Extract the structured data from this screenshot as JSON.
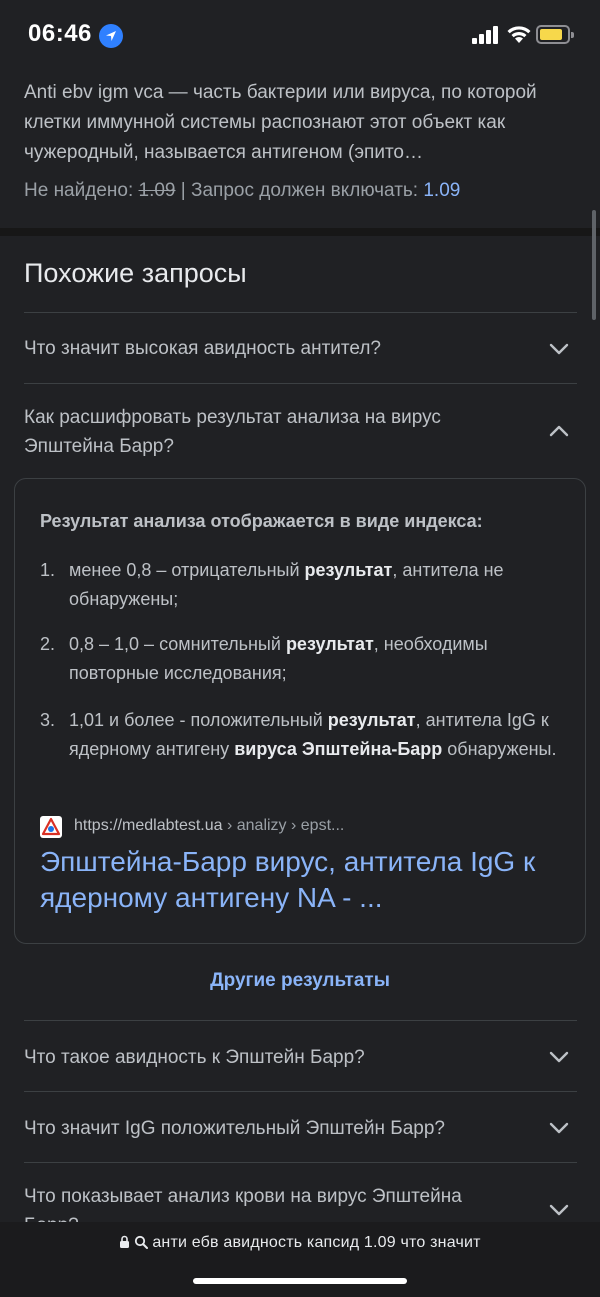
{
  "status": {
    "time": "06:46"
  },
  "snippet": {
    "text": "Anti ebv igm vca — часть бактерии или вируса, по которой клетки иммунной системы распознают этот объект как чужеродный, называется антигеном (эпито…",
    "missing_label": "Не найдено:",
    "missing_term": "1.09",
    "must_include_label": "| Запрос должен включать:",
    "must_include_term": "1.09"
  },
  "related": {
    "title": "Похожие запросы",
    "questions": [
      {
        "text": "Что значит высокая авидность антител?",
        "expanded": false
      },
      {
        "text": "Как расшифровать результат анализа на вирус Эпштейна Барр?",
        "expanded": true
      },
      {
        "text": "Что такое авидность к Эпштейн Барр?",
        "expanded": false
      },
      {
        "text": "Что значит IgG положительный Эпштейн Барр?",
        "expanded": false
      },
      {
        "text": "Что показывает анализ крови на вирус Эпштейна Барр?",
        "expanded": false
      }
    ]
  },
  "answer": {
    "heading": "Результат анализа отображается в виде индекса:",
    "items": [
      {
        "num": "1.",
        "pre": "менее 0,8 – отрицательный ",
        "bold1": "результат",
        "mid": ", антитела не обнаружены;",
        "bold2": "",
        "post": ""
      },
      {
        "num": "2.",
        "pre": "0,8 – 1,0 – сомнительный ",
        "bold1": "результат",
        "mid": ", необходимы повторные исследования;",
        "bold2": "",
        "post": ""
      },
      {
        "num": "3.",
        "pre": "1,01 и более - положительный ",
        "bold1": "результат",
        "mid": ", антитела IgG к ядерному антигену ",
        "bold2": "вируса Эпштейна-Барр",
        "post": " обнаружены."
      }
    ],
    "source_url": "https://medlabtest.ua",
    "source_crumbs": " › analizy › epst...",
    "source_title": "Эпштейна-Барр вирус, антитела IgG к ядерному антигену NA - ..."
  },
  "more_results": "Другие результаты",
  "bottom": {
    "url_text": "анти ебв авидность капсид 1.09 что значит"
  },
  "colors": {
    "background": "#202124",
    "link": "#8ab4f8",
    "text": "#bdc1c6"
  }
}
